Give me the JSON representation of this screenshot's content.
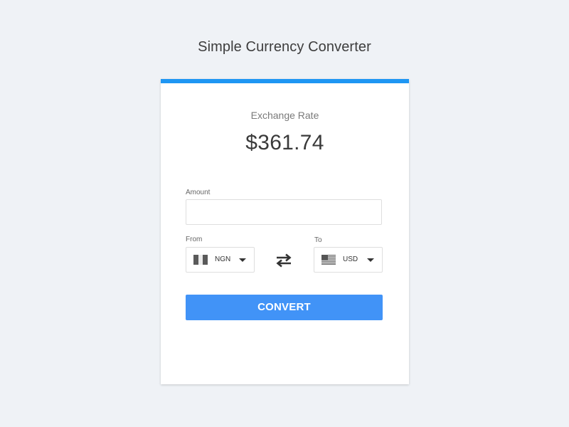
{
  "header": {
    "title": "Simple Currency Converter"
  },
  "converter": {
    "rate_label": "Exchange Rate",
    "rate_value": "$361.74",
    "amount_label": "Amount",
    "amount_value": "",
    "amount_placeholder": "",
    "from_label": "From",
    "to_label": "To",
    "from_currency": "NGN",
    "to_currency": "USD",
    "convert_label": "CONVERT"
  },
  "icons": {
    "from_flag": "nigeria-flag-icon",
    "to_flag": "us-flag-icon",
    "swap": "swap-arrows-icon",
    "dropdown": "caret-down-icon"
  },
  "colors": {
    "accent": "#1e96f3",
    "button": "#4193f7",
    "background": "#eff2f6"
  }
}
